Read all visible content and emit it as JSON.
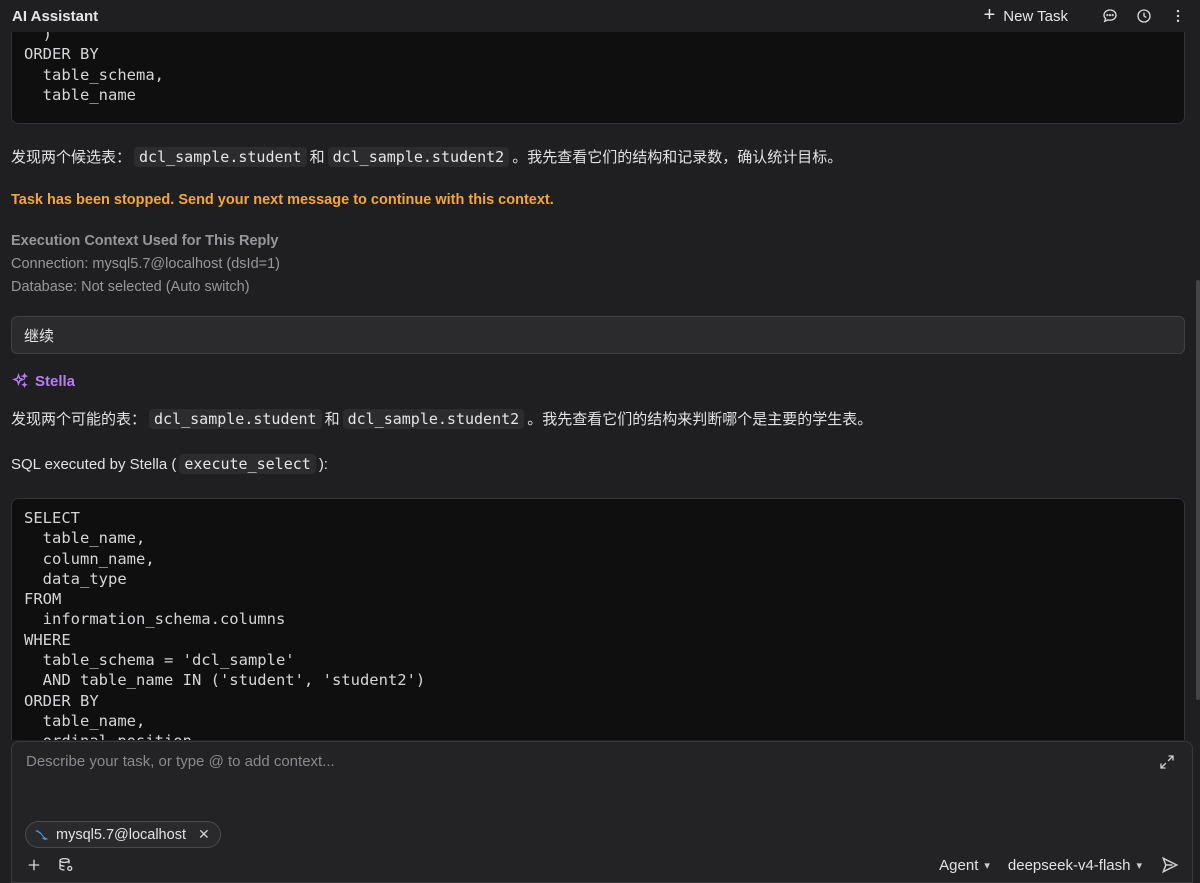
{
  "header": {
    "title": "AI Assistant",
    "new_task_label": "New Task"
  },
  "top_code": [
    "  )",
    "ORDER BY",
    "  table_schema,",
    "  table_name"
  ],
  "message1": {
    "prefix": "发现两个候选表：",
    "table1": "dcl_sample.student",
    "conj": "和",
    "table2": "dcl_sample.student2",
    "suffix": "。我先查看它们的结构和记录数，确认统计目标。"
  },
  "stopped_notice": "Task has been stopped. Send your next message to continue with this context.",
  "exec_context": {
    "title": "Execution Context Used for This Reply",
    "connection": "Connection: mysql5.7@localhost (dsId=1)",
    "database": "Database: Not selected (Auto switch)"
  },
  "user_message": "继续",
  "assistant_name": "Stella",
  "message2": {
    "prefix": "发现两个可能的表：",
    "table1": "dcl_sample.student",
    "conj": "和",
    "table2": "dcl_sample.student2",
    "suffix": "。我先查看它们的结构来判断哪个是主要的学生表。"
  },
  "sql_executed": {
    "prefix": "SQL executed by Stella (",
    "tool": "execute_select",
    "suffix": "):"
  },
  "bottom_code": [
    "SELECT",
    "  table_name,",
    "  column_name,",
    "  data_type",
    "FROM",
    "  information_schema.columns",
    "WHERE",
    "  table_schema = 'dcl_sample'",
    "  AND table_name IN ('student', 'student2')",
    "ORDER BY",
    "  table_name,",
    "  ordinal_position"
  ],
  "input": {
    "placeholder": "Describe your task, or type @ to add context...",
    "context_tag": "mysql5.7@localhost",
    "mode": "Agent",
    "model": "deepseek-v4-flash"
  },
  "colors": {
    "accent": "#b57ef5",
    "warning": "#f5a637",
    "background": "#1f1f21"
  }
}
